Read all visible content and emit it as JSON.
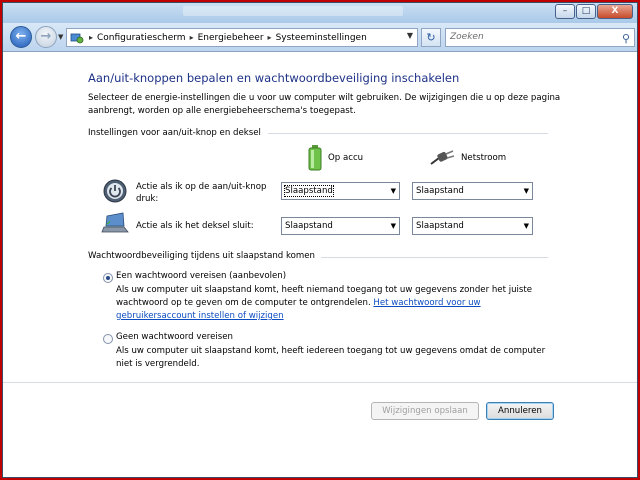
{
  "window": {
    "controls": {
      "minimize": "–",
      "maximize": "□",
      "close": "X"
    }
  },
  "navigation": {
    "breadcrumbs": [
      "Configuratiescherm",
      "Energiebeheer",
      "Systeeminstellingen"
    ],
    "search_placeholder": "Zoeken"
  },
  "page": {
    "title": "Aan/uit-knoppen bepalen en wachtwoordbeveiliging inschakelen",
    "intro": "Selecteer de energie-instellingen die u voor uw computer wilt gebruiken. De wijzigingen die u op deze pagina aanbrengt, worden op alle energiebeheerschema's toegepast."
  },
  "power_section": {
    "title": "Instellingen voor aan/uit-knop en deksel",
    "col_battery": "Op accu",
    "col_plugged": "Netstroom",
    "rows": [
      {
        "label": "Actie als ik op de aan/uit-knop druk:",
        "battery": "Slaapstand",
        "plugged": "Slaapstand"
      },
      {
        "label": "Actie als ik het deksel sluit:",
        "battery": "Slaapstand",
        "plugged": "Slaapstand"
      }
    ]
  },
  "password_section": {
    "title": "Wachtwoordbeveiliging tijdens uit slaapstand komen",
    "option1_label": "Een wachtwoord vereisen (aanbevolen)",
    "option1_desc": "Als uw computer uit slaapstand komt, heeft niemand toegang tot uw gegevens zonder het juiste wachtwoord op te geven om de computer te ontgrendelen.",
    "option1_link": "Het wachtwoord voor uw gebruikersaccount instellen of wijzigen",
    "option2_label": "Geen wachtwoord vereisen",
    "option2_desc": "Als uw computer uit slaapstand komt, heeft iedereen toegang tot uw gegevens omdat de computer niet is vergrendeld."
  },
  "buttons": {
    "save": "Wijzigingen opslaan",
    "cancel": "Annuleren"
  }
}
